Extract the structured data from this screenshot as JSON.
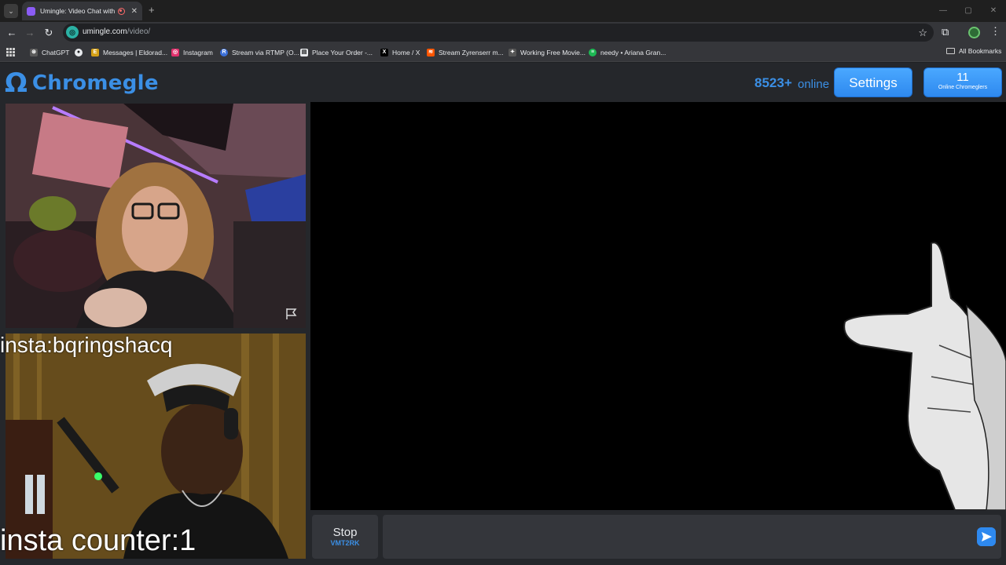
{
  "browser": {
    "tab": {
      "title": "Umingle: Video Chat with S",
      "close": "✕"
    },
    "new_tab": "+",
    "url": {
      "host": "umingle.com",
      "path": "/video/"
    },
    "window_controls": [
      "—",
      "▢",
      "✕"
    ],
    "bookmarks": [
      {
        "label": "ChatGPT",
        "color": "#5a5a5a"
      },
      {
        "label": "",
        "color": "#e8eaed"
      },
      {
        "label": "Messages | Eldorad...",
        "color": "#d4a017"
      },
      {
        "label": "Instagram",
        "color": "#e1306c"
      },
      {
        "label": "Stream via RTMP (O...",
        "color": "#3b6fd8"
      },
      {
        "label": "Place Your Order -...",
        "color": "#e8eaed"
      },
      {
        "label": "Home / X",
        "color": "#000000"
      },
      {
        "label": "Stream Zyrenserr m...",
        "color": "#ff5500"
      },
      {
        "label": "Working Free Movie...",
        "color": "#555555"
      },
      {
        "label": "needy • Ariana Gran...",
        "color": "#1db954"
      }
    ],
    "all_bookmarks": "All Bookmarks"
  },
  "app": {
    "logo_symbol": "Ω",
    "logo_text": "Chromegle",
    "online_count": "8523+",
    "online_label": "online",
    "settings_label": "Settings",
    "chromeglers_count": "11",
    "chromeglers_label": "Online Chromeglers"
  },
  "videos": {
    "overlay_top": "insta:bqringshacq",
    "overlay_bottom": "insta counter:1"
  },
  "chat": {
    "stop_label": "Stop",
    "stop_code": "VMT2RK",
    "input_value": "",
    "input_placeholder": ""
  },
  "colors": {
    "accent": "#3b8fe5",
    "page_bg": "#25272b",
    "panel": "#34363b"
  },
  "icons": [
    "tab-search-icon",
    "back-icon",
    "forward-icon",
    "reload-icon",
    "site-icon",
    "star-icon",
    "extensions-icon",
    "profile-icon",
    "menu-icon",
    "apps-icon",
    "folder-icon",
    "report-flag-icon",
    "send-icon"
  ]
}
